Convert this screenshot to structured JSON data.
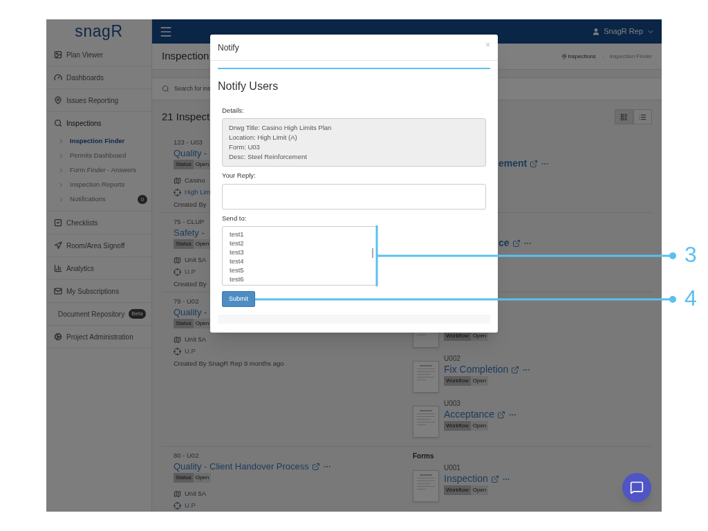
{
  "app": {
    "logo": "snagR",
    "user": "SnagR Rep"
  },
  "sidebar": {
    "items": [
      {
        "label": "Plan Viewer",
        "selected": false
      },
      {
        "label": "Dashboards",
        "selected": false
      },
      {
        "label": "Issues Reporting",
        "selected": false
      },
      {
        "label": "Inspections",
        "selected": false,
        "expanded": true,
        "children": [
          {
            "label": "Inspection Finder",
            "selected": true
          },
          {
            "label": "Permits Dashboard",
            "selected": false
          },
          {
            "label": "Form Finder - Answers",
            "selected": false
          },
          {
            "label": "Inspection Reports",
            "selected": false
          },
          {
            "label": "Notifications",
            "selected": false,
            "badge": "0"
          }
        ]
      },
      {
        "label": "Checklists",
        "selected": false
      },
      {
        "label": "Room/Area Signoff",
        "selected": false
      },
      {
        "label": "Analytics",
        "selected": false
      },
      {
        "label": "My Subscriptions",
        "selected": false
      },
      {
        "label": "Document Repository",
        "selected": false,
        "badge": "Beta"
      },
      {
        "label": "Project Administration",
        "selected": false
      }
    ]
  },
  "page": {
    "title": "Inspection",
    "breadcrumb": [
      "Inspections",
      "Inspection Finder"
    ],
    "search_placeholder": "Search for ins",
    "count": "21 Inspect",
    "view_toggle": [
      {
        "selected": true
      },
      {
        "selected": false
      }
    ]
  },
  "rows": [
    {
      "inspection": {
        "code": "123 - U03",
        "title": "Quality -",
        "status_label": "Status",
        "status": "Open",
        "location": "Casino",
        "area": "High Lim",
        "created": "Created By"
      },
      "forms": [
        {
          "kind": "partial",
          "title": "ement"
        }
      ]
    },
    {
      "inspection": {
        "code": "75 - CLUP",
        "title": "Safety -",
        "status_label": "Status",
        "status": "Open",
        "location": "Unit 5A",
        "area": "U.P",
        "created": "Created By"
      },
      "forms": [
        {
          "kind": "partial",
          "title": "ce"
        }
      ]
    },
    {
      "inspection": {
        "code": "79 - U02",
        "title": "Quality -",
        "status_label": "Status",
        "status": "Open",
        "location": "Unit 5A",
        "area": "U.P",
        "created": "Created By SnagR Rep 9 months ago"
      },
      "forms": [
        {
          "kind": "covered",
          "badge_label": "Workflow",
          "badge_value": "Open"
        },
        {
          "kind": "full",
          "code": "U002",
          "title": "Fix Completion",
          "badge_label": "Workflow",
          "badge_value": "Open"
        },
        {
          "kind": "full",
          "code": "U003",
          "title": "Acceptance",
          "badge_label": "Workflow",
          "badge_value": "Open"
        }
      ]
    },
    {
      "inspection": {
        "code": "80 - U02",
        "title": "Quality - Client Handover Process",
        "status_label": "Status",
        "status": "Open",
        "location": "Unit 5A",
        "area": "U.P"
      },
      "forms_heading": "Forms",
      "forms": [
        {
          "kind": "full",
          "code": "U001",
          "title": "Inspection",
          "badge_label": "Workflow",
          "badge_value": "Open"
        }
      ]
    }
  ],
  "modal": {
    "title": "Notify",
    "close": "×",
    "heading": "Notify Users",
    "details_label": "Details:",
    "details": [
      "Drwg Title: Casino High Limits Plan",
      "Location: High Limit (A)",
      "Form: U03",
      "Desc: Steel Reinforcement"
    ],
    "reply_label": "Your Reply:",
    "send_label": "Send to:",
    "recipients": [
      {
        "name": "test1",
        "selected": false
      },
      {
        "name": "test2",
        "selected": false
      },
      {
        "name": "test3",
        "selected": false
      },
      {
        "name": "test4",
        "selected": false
      },
      {
        "name": "test5",
        "selected": false
      },
      {
        "name": "test6",
        "selected": false
      }
    ],
    "submit": "Submit"
  },
  "callouts": [
    {
      "label": "3"
    },
    {
      "label": "4"
    }
  ]
}
